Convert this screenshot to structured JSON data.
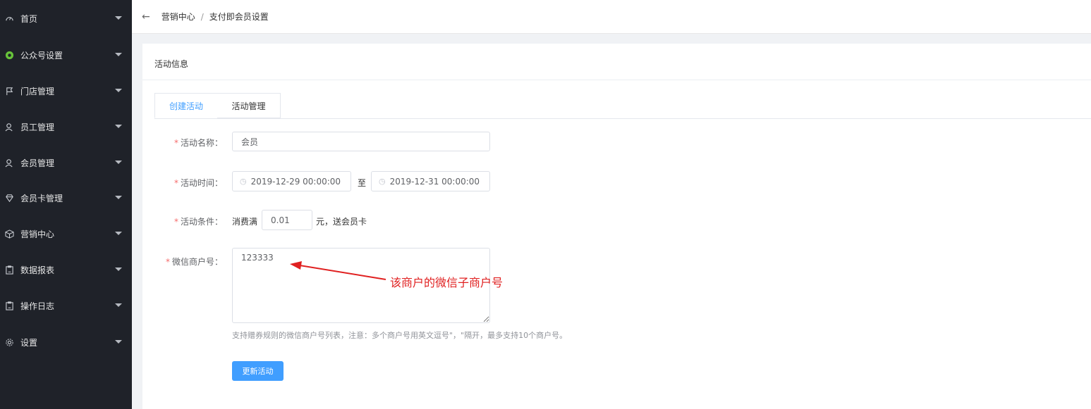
{
  "sidebar": {
    "items": [
      {
        "label": "首页",
        "icon": "dashboard-icon"
      },
      {
        "label": "公众号设置",
        "icon": "wechat-icon"
      },
      {
        "label": "门店管理",
        "icon": "flag-icon"
      },
      {
        "label": "员工管理",
        "icon": "user-icon"
      },
      {
        "label": "会员管理",
        "icon": "user-icon"
      },
      {
        "label": "会员卡管理",
        "icon": "diamond-icon"
      },
      {
        "label": "营销中心",
        "icon": "cube-icon"
      },
      {
        "label": "数据报表",
        "icon": "clipboard-icon"
      },
      {
        "label": "操作日志",
        "icon": "clipboard-icon"
      },
      {
        "label": "设置",
        "icon": "gear-icon"
      }
    ]
  },
  "header": {
    "back": "←",
    "breadcrumb": [
      "营销中心",
      "支付即会员设置"
    ],
    "separator": "/"
  },
  "card": {
    "title": "活动信息",
    "tabs": [
      "创建活动",
      "活动管理"
    ]
  },
  "form": {
    "name": {
      "label": "活动名称：",
      "value": "会员"
    },
    "time": {
      "label": "活动时间：",
      "start": "2019-12-29 00:00:00",
      "to": "至",
      "end": "2019-12-31 00:00:00"
    },
    "condition": {
      "label": "活动条件：",
      "prefix": "消费满",
      "value": "0.01",
      "suffix": "元，送会员卡"
    },
    "merchant": {
      "label": "微信商户号：",
      "value": "123333"
    },
    "hint": "支持赠券规则的微信商户号列表，注意：多个商户号用英文逗号\"，\"隔开，最多支持10个商户号。",
    "submit": "更新活动"
  },
  "annotation": {
    "text": "该商户的微信子商户号",
    "color": "#e02020"
  },
  "colors": {
    "sidebar_bg": "#1f2229",
    "primary": "#409eff",
    "wechat_green": "#67c23a",
    "required": "#f56c6c"
  }
}
